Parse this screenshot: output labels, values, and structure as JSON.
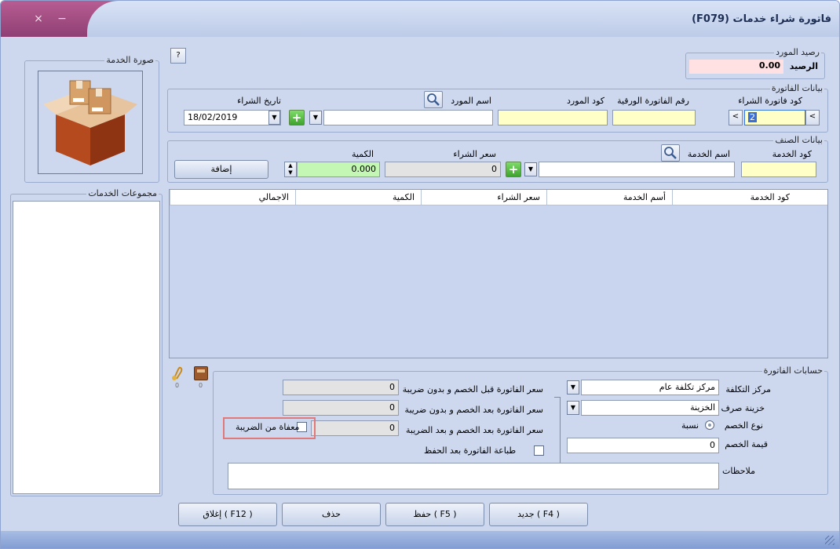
{
  "window": {
    "title": "فاتورة شراء خدمات  (F079)",
    "close_glyph": "×",
    "min_glyph": "−"
  },
  "help": {
    "label": "?"
  },
  "image_panel": {
    "legend": "صورة الخدمة"
  },
  "groups_panel": {
    "legend": "مجموعات الخدمات"
  },
  "balance": {
    "legend": "رصيد المورد",
    "label": "الرصيد",
    "value": "0.00"
  },
  "invoice": {
    "legend": "بيانات الفاتورة",
    "code_label": "كود فاتورة الشراء",
    "code_value": "2",
    "paper_no_label": "رقم الفاتورة الورقية",
    "paper_no_value": "",
    "supplier_code_label": "كود المورد",
    "supplier_code_value": "",
    "supplier_name_label": "اسم المورد",
    "supplier_name_value": "",
    "date_label": "تاريخ الشراء",
    "date_value": "18/02/2019"
  },
  "item": {
    "legend": "بيانات الصنف",
    "code_label": "كود الخدمة",
    "code_value": "",
    "name_label": "اسم الخدمة",
    "name_value": "",
    "price_label": "سعر الشراء",
    "price_value": "0",
    "qty_label": "الكمية",
    "qty_value": "0.000",
    "add_label": "إضافة"
  },
  "grid": {
    "columns": [
      "كود الخدمة",
      "أسم الخدمة",
      "سعر الشراء",
      "الكمية",
      "الاجمالي"
    ]
  },
  "accounts": {
    "legend": "حسابات الفاتورة",
    "cost_center_label": "مركز التكلفة",
    "cost_center_value": "مركز تكلفة عام",
    "treasury_label": "خزينة صرف",
    "treasury_value": "الخزينة",
    "discount_type_label": "نوع الخصم",
    "discount_type_option": "نسبة",
    "discount_value_label": "قيمة الخصم",
    "discount_value": "0",
    "before_discount_label": "سعر الفاتورة قبل الخصم و بدون ضريبة",
    "before_discount_value": "0",
    "after_discount_label": "سعر الفاتورة بعد الخصم و بدون ضريبة",
    "after_discount_value": "0",
    "after_tax_label": "سعر الفاتورة بعد الخصم و بعد الضريبة",
    "after_tax_value": "0",
    "tax_exempt_label": "معفاة من الضريبة",
    "print_after_save_label": "طباعة الفاتورة بعد الحفظ",
    "notes_label": "ملاحظات",
    "notes_value": "",
    "attach_count": "0",
    "box_count": "0"
  },
  "actions": {
    "new": "جديد ( F4 )",
    "save": "حفظ ( F5 )",
    "delete": "حذف",
    "close": "إغلاق ( F12 )"
  },
  "colors": {
    "highlight_box": "#e07a7a",
    "accent": "#b75d93"
  }
}
